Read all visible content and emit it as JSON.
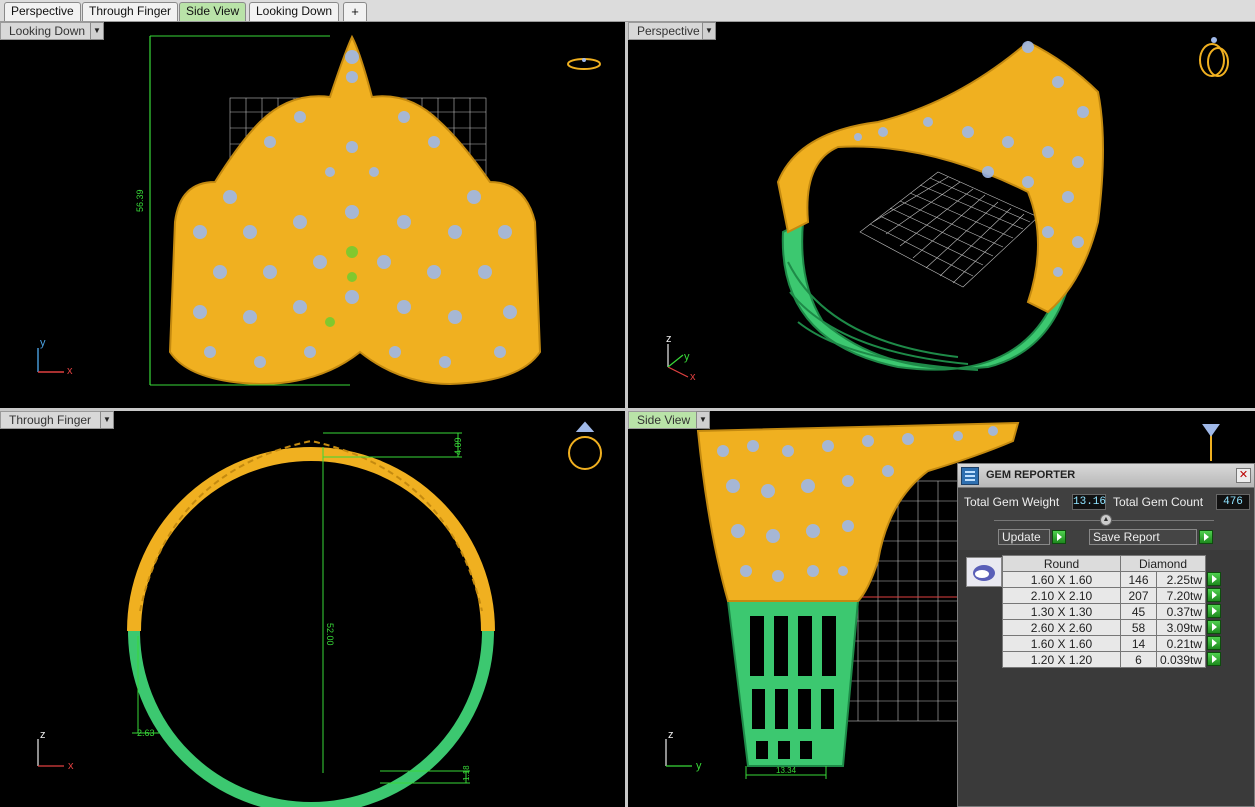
{
  "tabs": [
    {
      "label": "Perspective",
      "active": false
    },
    {
      "label": "Through Finger",
      "active": false
    },
    {
      "label": "Side View",
      "active": true
    },
    {
      "label": "Looking Down",
      "active": false
    }
  ],
  "add_tab_glyph": "+",
  "viewports": {
    "looking_down": {
      "label": "Looking Down",
      "dimension": "56.39",
      "axis_a": "y",
      "axis_b": "x"
    },
    "perspective": {
      "label": "Perspective",
      "axis_a": "z",
      "axis_b": "y",
      "axis_c": "x"
    },
    "through_finger": {
      "label": "Through Finger",
      "dim_top": "4.09",
      "dim_diameter": "52.00",
      "dim_left": "2.63",
      "dim_bottom": "1.18",
      "axis_a": "z",
      "axis_b": "x"
    },
    "side_view": {
      "label": "Side View",
      "dim_width": "13.34",
      "axis_a": "z",
      "axis_b": "y"
    }
  },
  "colors": {
    "gold": "#f0b020",
    "gold_dark": "#c48a10",
    "gem": "#9fb8e8",
    "green": "#3cc870",
    "green_dark": "#1e8a48",
    "grid": "#ffffff",
    "dim_line": "#38d838",
    "active_tab": "#b9e3a8"
  },
  "gem_reporter": {
    "title": "GEM REPORTER",
    "close_glyph": "✕",
    "total_weight_label": "Total Gem Weight",
    "total_weight": "13.16",
    "total_count_label": "Total Gem Count",
    "total_count": "476",
    "update_label": "Update",
    "save_label": "Save Report",
    "table": {
      "col_shape": "Round",
      "col_material": "Diamond",
      "rows": [
        {
          "size": "1.60 X 1.60",
          "count": "146",
          "weight": "2.25tw"
        },
        {
          "size": "2.10 X 2.10",
          "count": "207",
          "weight": "7.20tw"
        },
        {
          "size": "1.30 X 1.30",
          "count": "45",
          "weight": "0.37tw"
        },
        {
          "size": "2.60 X 2.60",
          "count": "58",
          "weight": "3.09tw"
        },
        {
          "size": "1.60 X 1.60",
          "count": "14",
          "weight": "0.21tw"
        },
        {
          "size": "1.20 X 1.20",
          "count": "6",
          "weight": "0.039tw"
        }
      ]
    }
  }
}
